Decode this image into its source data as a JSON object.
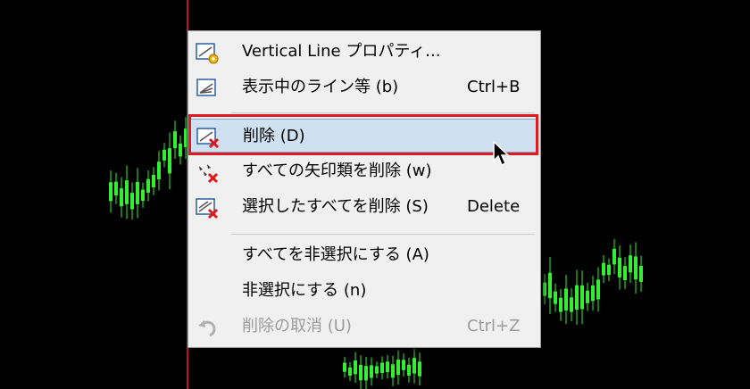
{
  "colors": {
    "background": "#000000",
    "candle": "#33ee33",
    "vertical_line": "#c0101a",
    "menu_bg": "#f0f0f0",
    "highlight_bg": "#cfe0f0",
    "highlight_outline": "#e11a1f",
    "disabled_text": "#9c9c9c"
  },
  "context_menu": {
    "items": [
      {
        "label": "Vertical Line プロパティ...",
        "shortcut": "",
        "icon": "line-properties-icon",
        "disabled": false
      },
      {
        "label": "表示中のライン等 (b)",
        "shortcut": "Ctrl+B",
        "icon": "objects-list-icon",
        "disabled": false
      },
      {
        "label": "削除 (D)",
        "shortcut": "",
        "icon": "delete-line-icon",
        "disabled": false,
        "highlighted": true
      },
      {
        "label": "すべての矢印類を削除 (w)",
        "shortcut": "",
        "icon": "delete-arrows-icon",
        "disabled": false
      },
      {
        "label": "選択したすべてを削除 (S)",
        "shortcut": "Delete",
        "icon": "delete-selected-icon",
        "disabled": false
      },
      {
        "label": "すべてを非選択にする (A)",
        "shortcut": "",
        "icon": "",
        "disabled": false
      },
      {
        "label": "非選択にする (n)",
        "shortcut": "",
        "icon": "",
        "disabled": false
      },
      {
        "label": "削除の取消 (U)",
        "shortcut": "Ctrl+Z",
        "icon": "undo-icon",
        "disabled": true
      }
    ]
  }
}
